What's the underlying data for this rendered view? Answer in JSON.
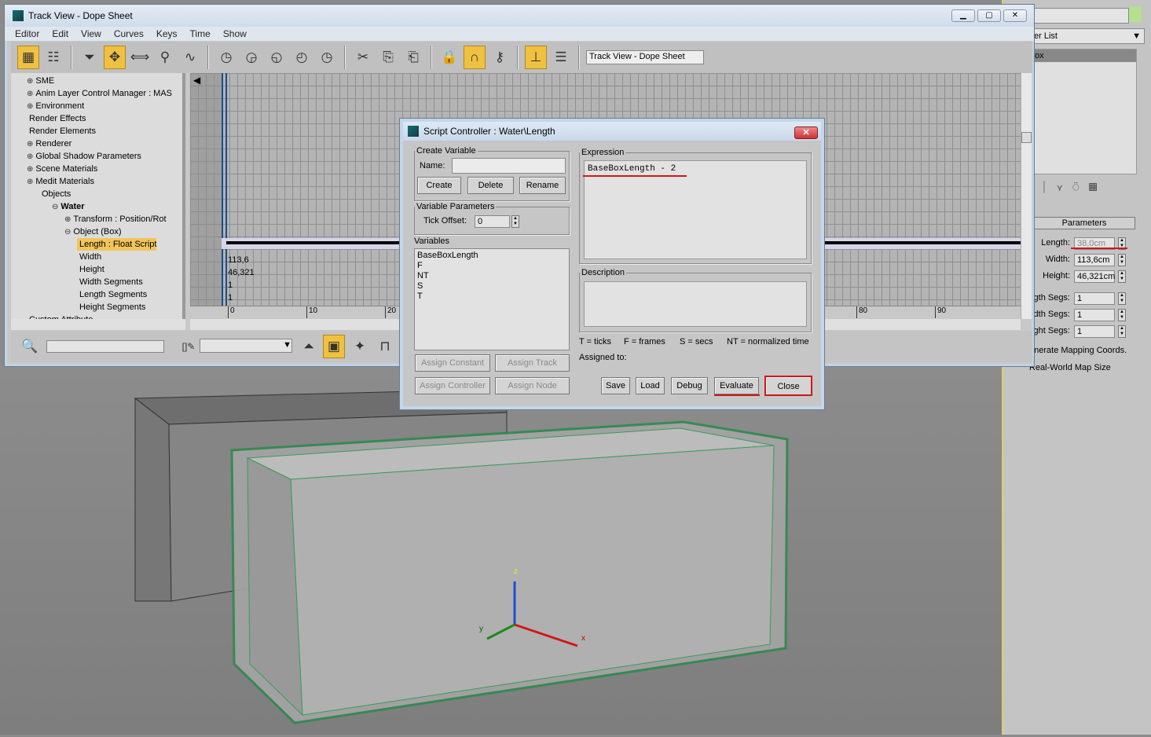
{
  "trackview": {
    "title": "Track View - Dope Sheet",
    "menu": [
      "Editor",
      "Edit",
      "View",
      "Curves",
      "Keys",
      "Time",
      "Show"
    ],
    "view_name": "Track View - Dope Sheet",
    "tree": [
      {
        "label": "SME",
        "exp": "+"
      },
      {
        "label": "Anim Layer Control Manager : MAS",
        "exp": "+"
      },
      {
        "label": "Environment",
        "exp": "+"
      },
      {
        "label": "Render Effects",
        "exp": ""
      },
      {
        "label": "Render Elements",
        "exp": ""
      },
      {
        "label": "Renderer",
        "exp": "+"
      },
      {
        "label": "Global Shadow Parameters",
        "exp": "+"
      },
      {
        "label": "Scene Materials",
        "exp": "+"
      },
      {
        "label": "Medit Materials",
        "exp": "+"
      },
      {
        "label": "Objects",
        "exp": ""
      },
      {
        "label": "Water",
        "exp": "−"
      },
      {
        "label": "Transform : Position/Rot",
        "exp": "+"
      },
      {
        "label": "Object (Box)",
        "exp": "−"
      },
      {
        "label": "Length : Float Script",
        "exp": ""
      },
      {
        "label": "Width",
        "exp": ""
      },
      {
        "label": "Height",
        "exp": ""
      },
      {
        "label": "Width Segments",
        "exp": ""
      },
      {
        "label": "Length Segments",
        "exp": ""
      },
      {
        "label": "Height Segments",
        "exp": ""
      },
      {
        "label": "Custom Attribute",
        "exp": ""
      }
    ],
    "track_values": [
      "113,6",
      "46,321",
      "1",
      "1"
    ],
    "ruler": [
      "0",
      "10",
      "20",
      "80",
      "90"
    ]
  },
  "dialog": {
    "title": "Script Controller : Water\\Length",
    "create_variable": "Create Variable",
    "name_label": "Name:",
    "name_value": "",
    "create": "Create",
    "delete": "Delete",
    "rename": "Rename",
    "variable_parameters": "Variable Parameters",
    "tick_offset_label": "Tick Offset:",
    "tick_offset": "0",
    "variables_label": "Variables",
    "variables": [
      "BaseBoxLength",
      "F",
      "NT",
      "S",
      "T"
    ],
    "assign_constant": "Assign Constant",
    "assign_track": "Assign Track",
    "assign_controller": "Assign Controller",
    "assign_node": "Assign Node",
    "expression_label": "Expression",
    "expression": "BaseBoxLength - 2",
    "description_label": "Description",
    "legend": [
      "T = ticks",
      "F = frames",
      "S = secs",
      "NT = normalized time"
    ],
    "assigned_to": "Assigned to:",
    "save": "Save",
    "load": "Load",
    "debug": "Debug",
    "evaluate": "Evaluate",
    "close": "Close"
  },
  "command_panel": {
    "modifier_list": "er List",
    "stack_item": "ox",
    "parameters": "Parameters",
    "fields": [
      {
        "label": "Length:",
        "value": "38,0cm"
      },
      {
        "label": "Width:",
        "value": "113,6cm"
      },
      {
        "label": "Height:",
        "value": "46,321cm"
      },
      {
        "label": "gth Segs:",
        "value": "1"
      },
      {
        "label": "dth Segs:",
        "value": "1"
      },
      {
        "label": "ght Segs:",
        "value": "1"
      }
    ],
    "gen_mapping": "enerate Mapping Coords.",
    "real_world": "Real-World Map Size"
  },
  "viewport": {
    "axis_x": "x",
    "axis_y": "y",
    "axis_z": "z"
  }
}
